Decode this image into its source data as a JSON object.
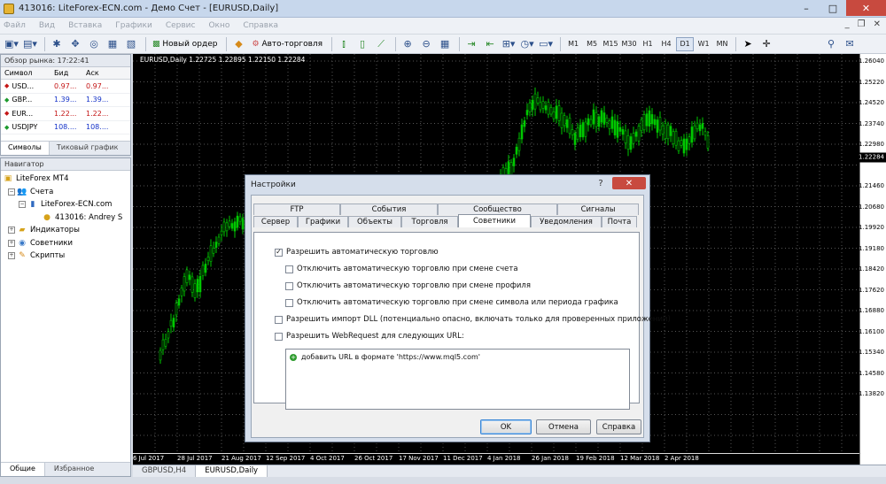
{
  "window": {
    "title": "413016: LiteForex-ECN.com - Демо Счет - [EURUSD,Daily]",
    "minimize": "–",
    "maximize": "□",
    "close": "✕"
  },
  "menu": [
    "Файл",
    "Вид",
    "Вставка",
    "Графики",
    "Сервис",
    "Окно",
    "Справка"
  ],
  "toolbar": {
    "new_order": "Новый ордер",
    "auto_trading": "Авто-торговля",
    "timeframes": [
      "M1",
      "M5",
      "M15",
      "M30",
      "H1",
      "H4",
      "D1",
      "W1",
      "MN"
    ],
    "selected_timeframe": "D1"
  },
  "market_watch": {
    "header": "Обзор рынка: 17:22:41",
    "columns": [
      "Символ",
      "Бид",
      "Аск"
    ],
    "rows": [
      {
        "symbol": "USD...",
        "bid": "0.97...",
        "ask": "0.97...",
        "color": "red"
      },
      {
        "symbol": "GBP...",
        "bid": "1.39...",
        "ask": "1.39...",
        "color": "blue"
      },
      {
        "symbol": "EUR...",
        "bid": "1.22...",
        "ask": "1.22...",
        "color": "red"
      },
      {
        "symbol": "USDJPY",
        "bid": "108....",
        "ask": "108....",
        "color": "blue"
      }
    ],
    "tabs": [
      "Символы",
      "Тиковый график"
    ]
  },
  "navigator": {
    "header": "Навигатор",
    "tree": {
      "root": "LiteForex MT4",
      "accounts": "Счета",
      "server": "LiteForex-ECN.com",
      "account": "413016: Andrey S",
      "indicators": "Индикаторы",
      "experts": "Советники",
      "scripts": "Скрипты"
    },
    "tabs": [
      "Общие",
      "Избранное"
    ]
  },
  "chart": {
    "symbol_info": "EURUSD,Daily  1.22725 1.22895 1.22150 1.22284",
    "current_price": "1.22284",
    "price_labels": [
      "1.26040",
      "1.25220",
      "1.24520",
      "1.23740",
      "1.22980",
      "1.21460",
      "1.20680",
      "1.19920",
      "1.19180",
      "1.18420",
      "1.17620",
      "1.16880",
      "1.16100",
      "1.15340",
      "1.14580",
      "1.13820"
    ],
    "time_labels": [
      "6 Jul 2017",
      "28 Jul 2017",
      "21 Aug 2017",
      "12 Sep 2017",
      "4 Oct 2017",
      "26 Oct 2017",
      "17 Nov 2017",
      "11 Dec 2017",
      "4 Jan 2018",
      "26 Jan 2018",
      "19 Feb 2018",
      "12 Mar 2018",
      "2 Apr 2018"
    ],
    "tabs": [
      "GBPUSD,H4",
      "EURUSD,Daily"
    ],
    "active_tab": "EURUSD,Daily",
    "candle_color": "#00c800"
  },
  "dialog": {
    "title": "Настройки",
    "tabs_top": [
      "FTP",
      "События",
      "Сообщество",
      "Сигналы"
    ],
    "tabs_bottom": [
      "Сервер",
      "Графики",
      "Объекты",
      "Торговля",
      "Советники",
      "Уведомления",
      "Почта"
    ],
    "active_tab": "Советники",
    "options": [
      {
        "label": "Разрешить автоматическую торговлю",
        "checked": true
      },
      {
        "label": "Отключить автоматическую торговлю при смене счета",
        "checked": false
      },
      {
        "label": "Отключить автоматическую торговлю при смене профиля",
        "checked": false
      },
      {
        "label": "Отключить автоматическую торговлю при смене символа или периода графика",
        "checked": false
      },
      {
        "label": "Разрешить импорт DLL (потенциально опасно, включать только для проверенных приложений)",
        "checked": false
      },
      {
        "label": "Разрешить WebRequest для следующих URL:",
        "checked": false
      }
    ],
    "url_add": "добавить URL в формате 'https://www.mql5.com'",
    "ok": "OK",
    "cancel": "Отмена",
    "help": "Справка"
  }
}
